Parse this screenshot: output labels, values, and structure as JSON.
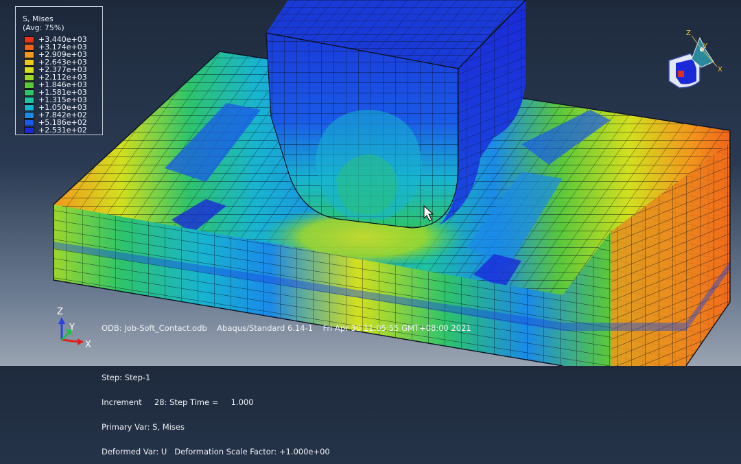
{
  "legend": {
    "title": "S, Mises",
    "subtitle": "(Avg: 75%)",
    "entries": [
      {
        "label": "+3.440e+03",
        "color": "#e8321a"
      },
      {
        "label": "+3.174e+03",
        "color": "#f0641a"
      },
      {
        "label": "+2.909e+03",
        "color": "#f2981c"
      },
      {
        "label": "+2.643e+03",
        "color": "#ecc81c"
      },
      {
        "label": "+2.377e+03",
        "color": "#d2e01e"
      },
      {
        "label": "+2.112e+03",
        "color": "#9cd82a"
      },
      {
        "label": "+1.846e+03",
        "color": "#5ac83a"
      },
      {
        "label": "+1.581e+03",
        "color": "#2ec46a"
      },
      {
        "label": "+1.315e+03",
        "color": "#1ec4a0"
      },
      {
        "label": "+1.050e+03",
        "color": "#18b4d0"
      },
      {
        "label": "+7.842e+02",
        "color": "#1a8ae8"
      },
      {
        "label": "+5.186e+02",
        "color": "#1a5ae8"
      },
      {
        "label": "+2.531e+02",
        "color": "#1a2ad8"
      }
    ]
  },
  "info": {
    "odb": "ODB: Job-Soft_Contact.odb    Abaqus/Standard 6.14-1    Fri Apr 30 11:05:55 GMT+08:00 2021",
    "step": "Step: Step-1",
    "increment": "Increment     28: Step Time =     1.000",
    "primary_var": "Primary Var: S, Mises",
    "deformed_var": "Deformed Var: U   Deformation Scale Factor: +1.000e+00"
  },
  "triad": {
    "z": "Z",
    "y": "Y",
    "x": "X"
  },
  "view_cube": {
    "z": "Z",
    "y": "Y",
    "x": "X"
  },
  "colors": {
    "mesh_line": "#0a1020",
    "punch_base": "#1a4fd6"
  }
}
